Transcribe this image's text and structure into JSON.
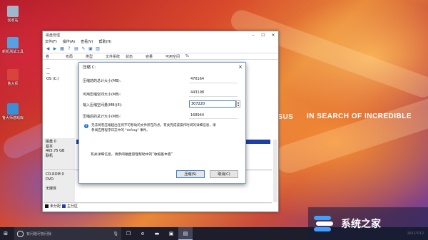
{
  "desktop": {
    "icons": [
      {
        "label": "回收站",
        "color": "#9fb6cc"
      },
      {
        "label": "新机测试工具",
        "color": "#5aa0e0"
      },
      {
        "label": "鲁大师",
        "color": "#d8443c"
      },
      {
        "label": "鲁大师游戏库",
        "color": "#3b8fd6"
      }
    ],
    "brand_logo": "/SUS",
    "brand_tagline": "IN SEARCH OF INCREDIBLE"
  },
  "disk_mgmt": {
    "title": "磁盘管理",
    "menu": [
      "文件(F)",
      "操作(A)",
      "查看(V)",
      "帮助(H)"
    ],
    "columns": [
      "卷",
      "布局",
      "类型",
      "文件系统",
      "状态",
      "容量",
      "可用空间",
      "%"
    ],
    "volumes": [
      "—",
      "—",
      "OS (C:)"
    ],
    "disk0": {
      "name": "磁盘 0",
      "type": "基本",
      "size": "465.75 GB",
      "status": "联机"
    },
    "cdrom0": {
      "name": "CD-ROM 0",
      "type": "DVD",
      "status": "无媒体"
    },
    "legend": [
      {
        "label": "未分配",
        "color": "#111111"
      },
      {
        "label": "主分区",
        "color": "#1f3fa6"
      }
    ]
  },
  "dialog": {
    "title": "压缩 C:",
    "fields": [
      {
        "label": "压缩前的总计大小(MB):",
        "value": "476164"
      },
      {
        "label": "可用压缩空间大小(MB):",
        "value": "443198"
      },
      {
        "label": "输入压缩空间量(MB)(E):",
        "value": "307220"
      },
      {
        "label": "压缩后的总计大小(MB):",
        "value": "168944"
      }
    ],
    "info_line1": "无法将卷压缩超出任何不可移动的文件所在的点。有关完成该操作时间的详细信息，请",
    "info_line2": "参阅应用程序日志中的 \"defrag\" 事件。",
    "more_info": "有关详细信息，请参阅磁盘管理帮助中的“收缩基本卷”",
    "compress_label": "压缩(S)",
    "cancel_label": "取消(C)"
  },
  "taskbar": {
    "search_placeholder": "有问题尽管问我",
    "date_time": "2017/7/12"
  },
  "watermark": {
    "text": "系统之家"
  }
}
